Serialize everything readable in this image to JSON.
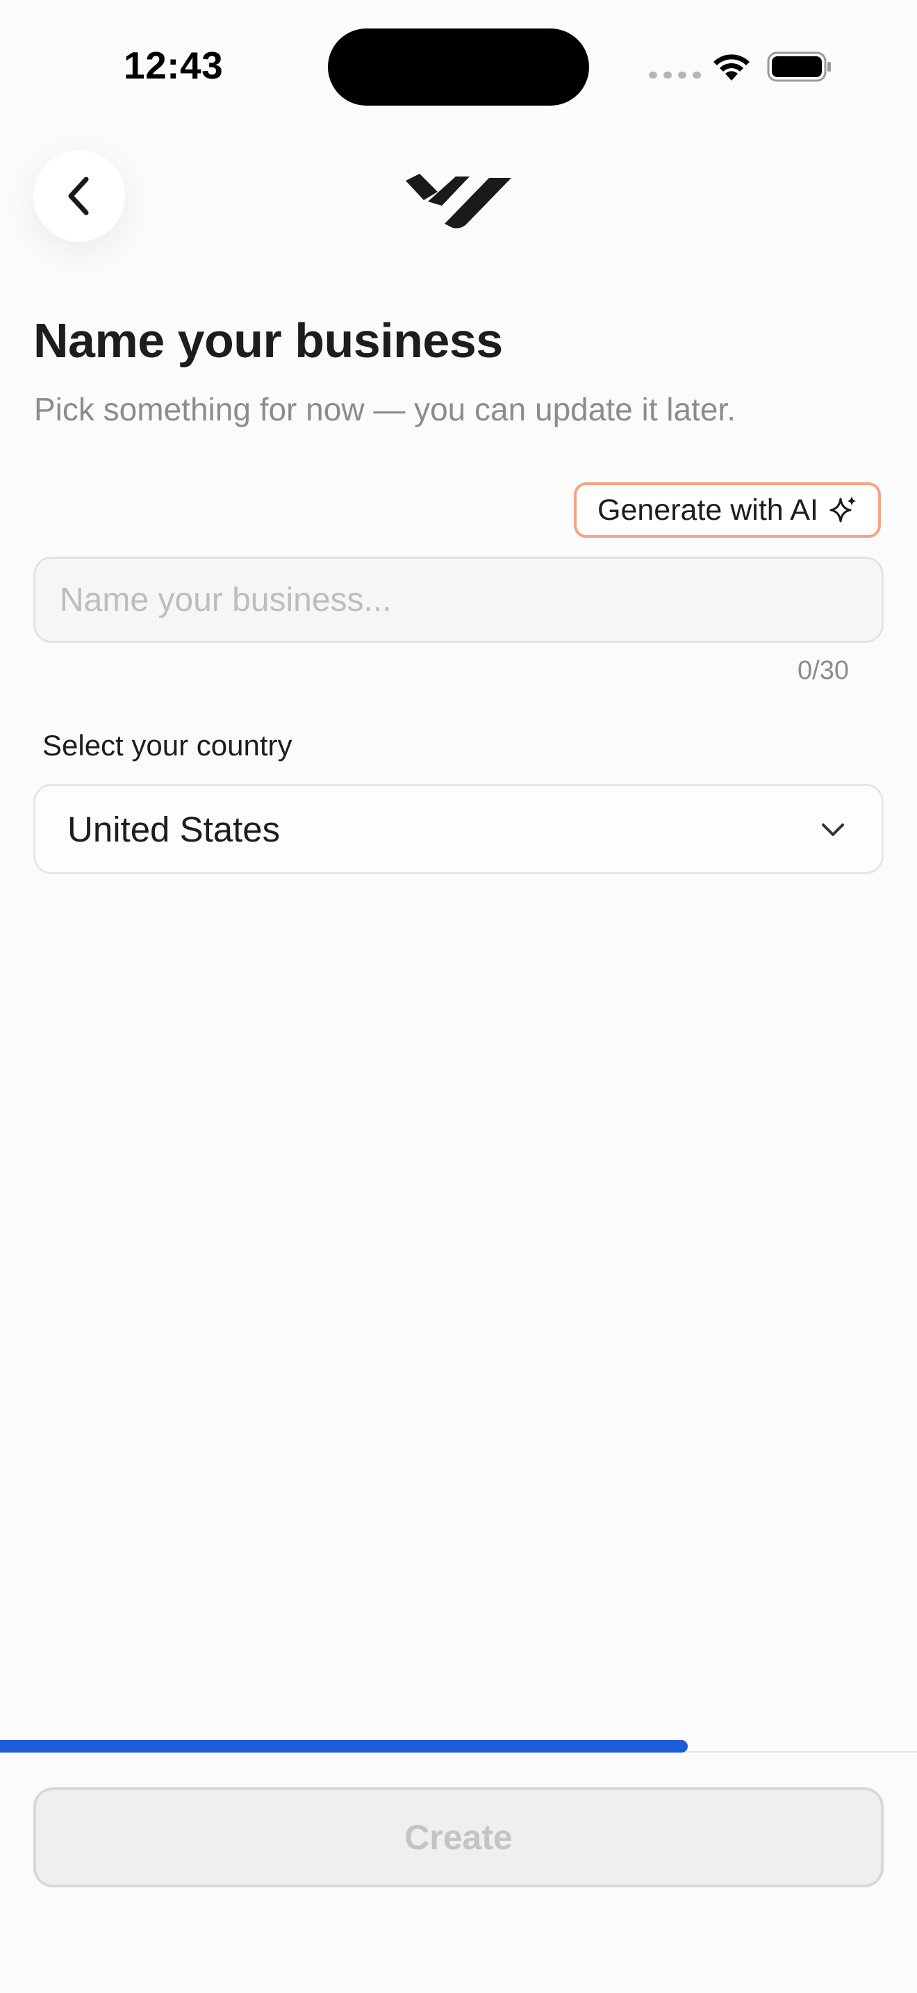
{
  "status_bar": {
    "time": "12:43"
  },
  "header": {
    "back_icon": "chevron-left-icon",
    "logo_icon": "brand-logo-icon"
  },
  "page": {
    "title": "Name your business",
    "subtitle": "Pick something for now — you can update it later."
  },
  "ai_button": {
    "label": "Generate with AI",
    "icon": "sparkle-icon",
    "border_color": "#f4a584"
  },
  "business_name": {
    "value": "",
    "placeholder": "Name your business...",
    "char_count": "0/30"
  },
  "country": {
    "label": "Select your country",
    "selected": "United States",
    "icon": "chevron-down-icon"
  },
  "progress": {
    "fraction": 0.75,
    "color": "#1e5bd8"
  },
  "create_button": {
    "label": "Create",
    "enabled": false
  }
}
